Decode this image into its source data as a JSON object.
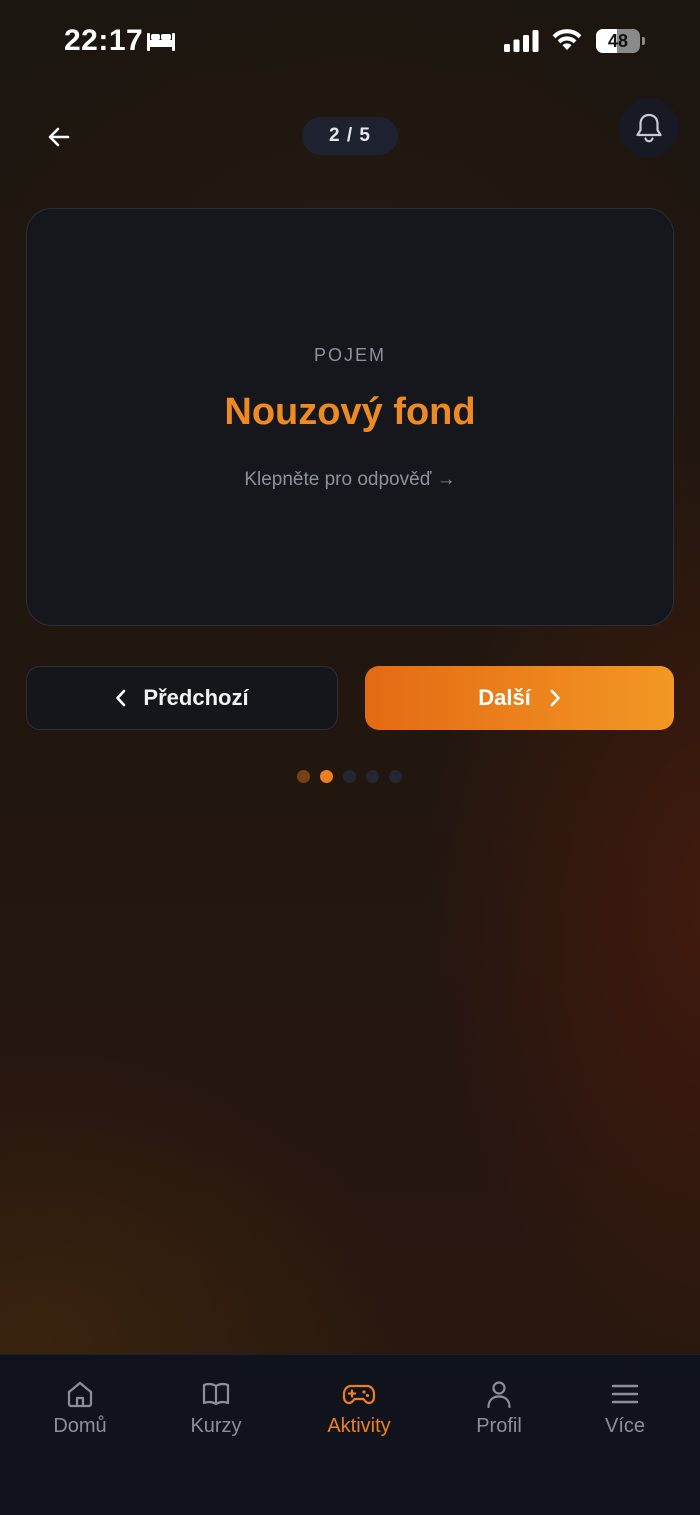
{
  "status_bar": {
    "time": "22:17",
    "battery_level": "48",
    "battery_fraction": 0.48
  },
  "header": {
    "progress_text": "2 / 5",
    "current": 2,
    "total": 5
  },
  "card": {
    "label": "POJEM",
    "term": "Nouzový fond",
    "hint": "Klepněte pro odpověď →"
  },
  "navigation": {
    "prev_label": "Předchozí",
    "next_label": "Další"
  },
  "colors": {
    "accent": "#ee7f1f",
    "card_bg": "#16171d",
    "tab_bar_bg": "#11131c"
  },
  "tab_bar": {
    "items": [
      {
        "label": "Domů",
        "icon": "home-icon",
        "active": false
      },
      {
        "label": "Kurzy",
        "icon": "book-icon",
        "active": false
      },
      {
        "label": "Aktivity",
        "icon": "gamepad-icon",
        "active": true
      },
      {
        "label": "Profil",
        "icon": "user-icon",
        "active": false
      },
      {
        "label": "Více",
        "icon": "menu-icon",
        "active": false
      }
    ]
  }
}
